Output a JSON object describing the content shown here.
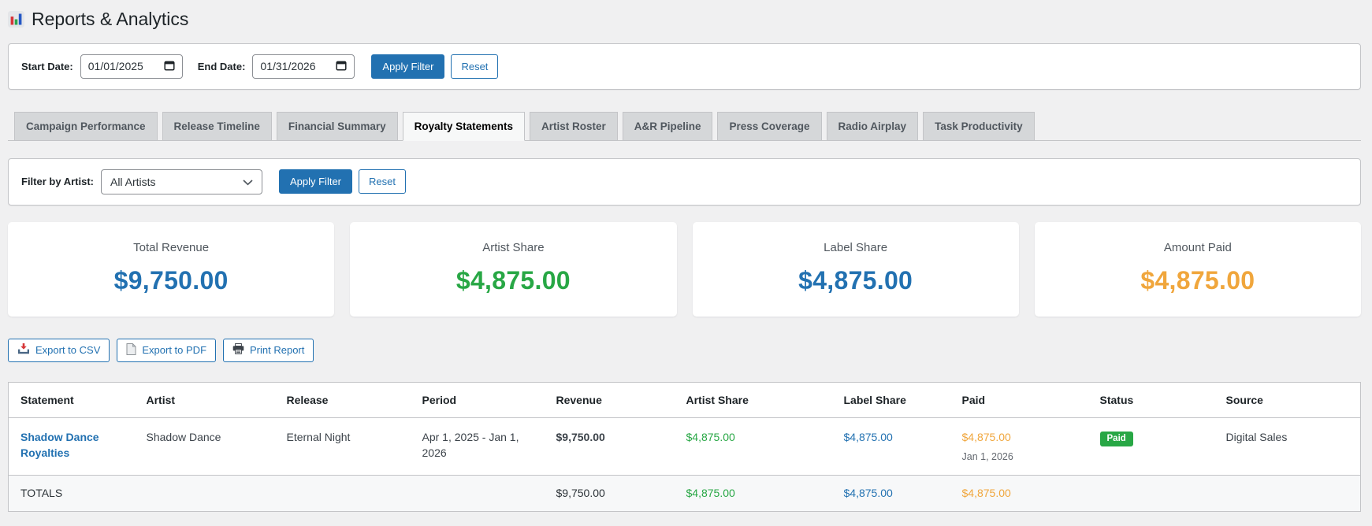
{
  "header": {
    "title": "Reports & Analytics"
  },
  "date_filter": {
    "start_label": "Start Date:",
    "start_value": "01/01/2025",
    "end_label": "End Date:",
    "end_value": "01/31/2026",
    "apply_label": "Apply Filter",
    "reset_label": "Reset"
  },
  "tabs": [
    {
      "label": "Campaign Performance",
      "active": false
    },
    {
      "label": "Release Timeline",
      "active": false
    },
    {
      "label": "Financial Summary",
      "active": false
    },
    {
      "label": "Royalty Statements",
      "active": true
    },
    {
      "label": "Artist Roster",
      "active": false
    },
    {
      "label": "A&R Pipeline",
      "active": false
    },
    {
      "label": "Press Coverage",
      "active": false
    },
    {
      "label": "Radio Airplay",
      "active": false
    },
    {
      "label": "Task Productivity",
      "active": false
    }
  ],
  "artist_filter": {
    "label": "Filter by Artist:",
    "selected_option": "All Artists",
    "apply_label": "Apply Filter",
    "reset_label": "Reset"
  },
  "summary_cards": [
    {
      "label": "Total Revenue",
      "value": "$9,750.00",
      "color": "#2271b1"
    },
    {
      "label": "Artist Share",
      "value": "$4,875.00",
      "color": "#28a745"
    },
    {
      "label": "Label Share",
      "value": "$4,875.00",
      "color": "#2271b1"
    },
    {
      "label": "Amount Paid",
      "value": "$4,875.00",
      "color": "#f0a63c"
    }
  ],
  "export": {
    "csv_label": "Export to CSV",
    "pdf_label": "Export to PDF",
    "print_label": "Print Report"
  },
  "table": {
    "headers": [
      "Statement",
      "Artist",
      "Release",
      "Period",
      "Revenue",
      "Artist Share",
      "Label Share",
      "Paid",
      "Status",
      "Source"
    ],
    "rows": [
      {
        "statement": "Shadow Dance Royalties",
        "artist": "Shadow Dance",
        "release": "Eternal Night",
        "period": "Apr 1, 2025 - Jan 1, 2026",
        "revenue": "$9,750.00",
        "artist_share": "$4,875.00",
        "label_share": "$4,875.00",
        "paid_amount": "$4,875.00",
        "paid_date": "Jan 1, 2026",
        "status": "Paid",
        "source": "Digital Sales"
      }
    ],
    "totals": {
      "label": "TOTALS",
      "revenue": "$9,750.00",
      "artist_share": "$4,875.00",
      "label_share": "$4,875.00",
      "paid": "$4,875.00"
    }
  },
  "colors": {
    "primary_blue": "#2271b1",
    "green": "#28a745",
    "orange": "#f0a63c",
    "page_bg": "#f0f0f1"
  }
}
